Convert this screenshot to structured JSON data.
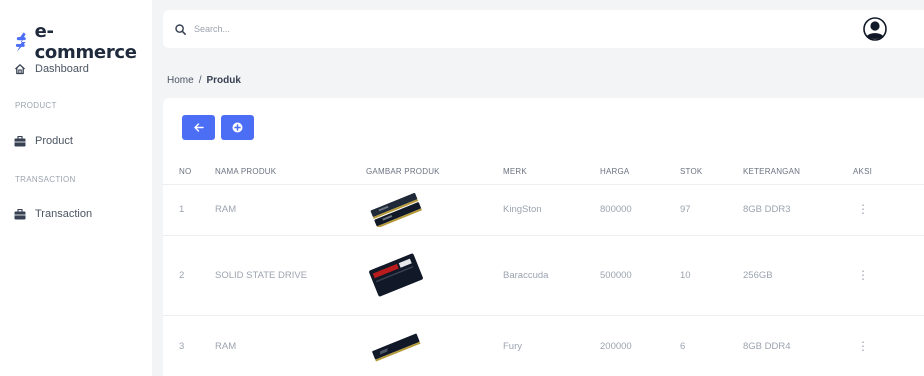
{
  "brand": {
    "name": "e-commerce",
    "logo_icon": "dollar-sign-icon",
    "logo_color": "#4c6ef5"
  },
  "sidebar": {
    "dashboard": {
      "label": "Dashboard",
      "icon": "home-icon"
    },
    "sections": [
      {
        "title": "PRODUCT",
        "items": [
          {
            "label": "Product",
            "icon": "briefcase-icon"
          }
        ]
      },
      {
        "title": "TRANSACTION",
        "items": [
          {
            "label": "Transaction",
            "icon": "briefcase-icon"
          }
        ]
      }
    ]
  },
  "topbar": {
    "search_placeholder": "Search...",
    "search_icon": "search-icon",
    "avatar_icon": "user-avatar-icon"
  },
  "breadcrumb": {
    "home": "Home",
    "separator": "/",
    "current": "Produk"
  },
  "toolbar": {
    "back_icon": "arrow-left-icon",
    "add_icon": "plus-circle-icon",
    "button_color": "#4c6ef5"
  },
  "table": {
    "headers": [
      "NO",
      "NAMA PRODUK",
      "GAMBAR PRODUK",
      "MERK",
      "HARGA",
      "STOK",
      "KETERANGAN",
      "AKSI"
    ],
    "rows": [
      {
        "no": "1",
        "nama": "RAM",
        "gambar": "ram-dual-image",
        "merk": "KingSton",
        "harga": "800000",
        "stok": "97",
        "keterangan": "8GB DDR3",
        "aksi": "⋮"
      },
      {
        "no": "2",
        "nama": "SOLID STATE DRIVE",
        "gambar": "ssd-image",
        "merk": "Baraccuda",
        "harga": "500000",
        "stok": "10",
        "keterangan": "256GB",
        "aksi": "⋮"
      },
      {
        "no": "3",
        "nama": "RAM",
        "gambar": "ram-single-image",
        "merk": "Fury",
        "harga": "200000",
        "stok": "6",
        "keterangan": "8GB DDR4",
        "aksi": "⋮"
      }
    ]
  }
}
